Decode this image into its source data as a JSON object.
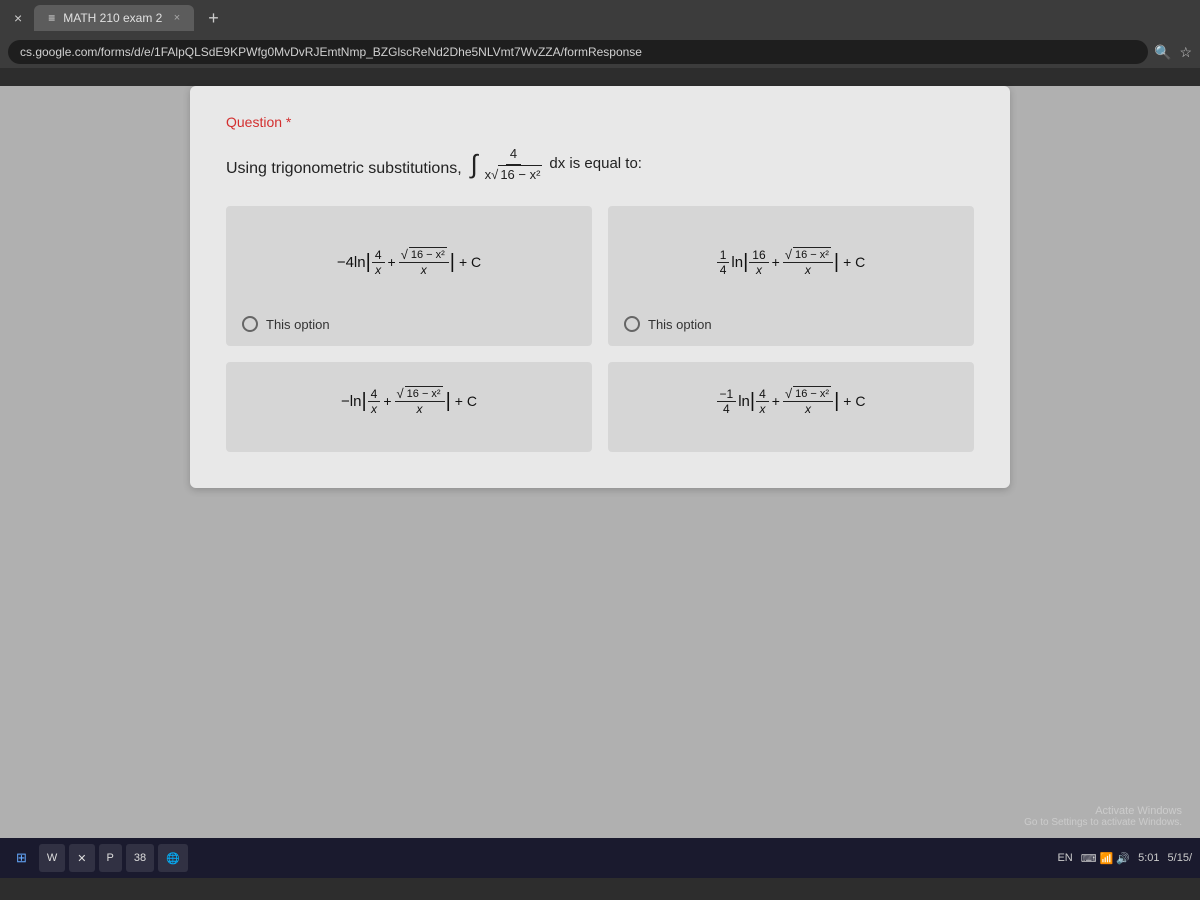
{
  "browser": {
    "tab_title": "MATH 210 exam 2",
    "tab_icon": "≡",
    "close_label": "×",
    "new_tab_label": "+",
    "address": "cs.google.com/forms/d/e/1FAlpQLSdE9KPWfg0MvDvRJEmtNmp_BZGlscReNd2Dhe5NLVmt7WvZZA/formResponse",
    "search_icon": "🔍",
    "star_icon": "☆"
  },
  "question": {
    "label": "Question",
    "required_star": "*",
    "text": "Using trigonometric substitutions,",
    "integral_display": "∫ 4/(x√(16−x²)) dx is equal to:",
    "options": [
      {
        "id": "A",
        "formula_html": "option_a",
        "label": "This option"
      },
      {
        "id": "B",
        "formula_html": "option_b",
        "label": "This option"
      },
      {
        "id": "C",
        "formula_html": "option_c",
        "label": ""
      },
      {
        "id": "D",
        "formula_html": "option_d",
        "label": ""
      }
    ]
  },
  "taskbar": {
    "items": [
      "W",
      "X",
      "P",
      "38"
    ],
    "time": "5:01",
    "date": "5/15/",
    "lang": "EN"
  },
  "watermark": "Activate Windows"
}
